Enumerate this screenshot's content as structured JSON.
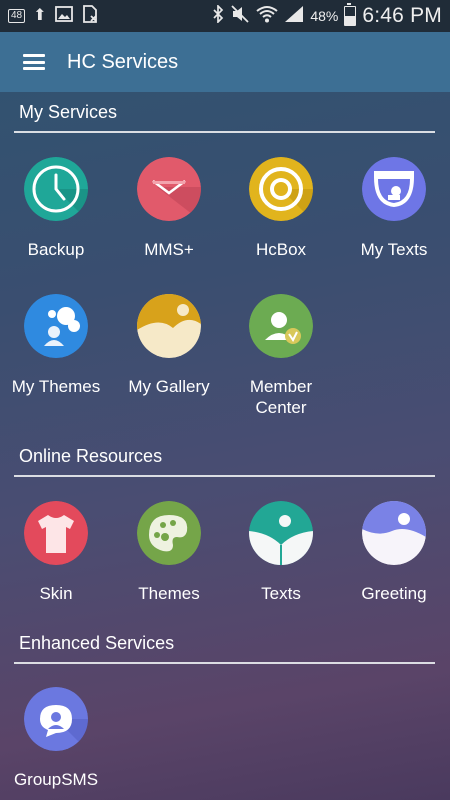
{
  "status_bar": {
    "left_badge": "48",
    "battery": "48%",
    "time": "6:46 PM"
  },
  "toolbar": {
    "title": "HC Services"
  },
  "sections": [
    {
      "title": "My Services"
    },
    {
      "title": "Online Resources"
    },
    {
      "title": "Enhanced Services"
    }
  ],
  "my_services": [
    {
      "label": "Backup",
      "icon": "clock-icon",
      "color": "#1fa798"
    },
    {
      "label": "MMS+",
      "icon": "envelope-icon",
      "color": "#e15a6b"
    },
    {
      "label": "HcBox",
      "icon": "box-icon",
      "color": "#e1b41d"
    },
    {
      "label": "My Texts",
      "icon": "texts-icon",
      "color": "#6e76e6"
    },
    {
      "label": "My Themes",
      "icon": "themes-icon",
      "color": "#2f8ae0"
    },
    {
      "label": "My Gallery",
      "icon": "gallery-icon",
      "color": "#f6e9c8"
    },
    {
      "label": "Member\nCenter",
      "icon": "member-icon",
      "color": "#6cab52"
    }
  ],
  "online_resources": [
    {
      "label": "Skin",
      "icon": "shirt-icon",
      "color": "#e34a5c"
    },
    {
      "label": "Themes",
      "icon": "palette-icon",
      "color": "#75a549"
    },
    {
      "label": "Texts",
      "icon": "leaf-icon",
      "color": "#22a795"
    },
    {
      "label": "Greeting",
      "icon": "greeting-icon",
      "color": "#7a82e6"
    }
  ],
  "enhanced_services": [
    {
      "label": "GroupSMS",
      "icon": "group-sms-icon",
      "color": "#6b78e0"
    }
  ]
}
